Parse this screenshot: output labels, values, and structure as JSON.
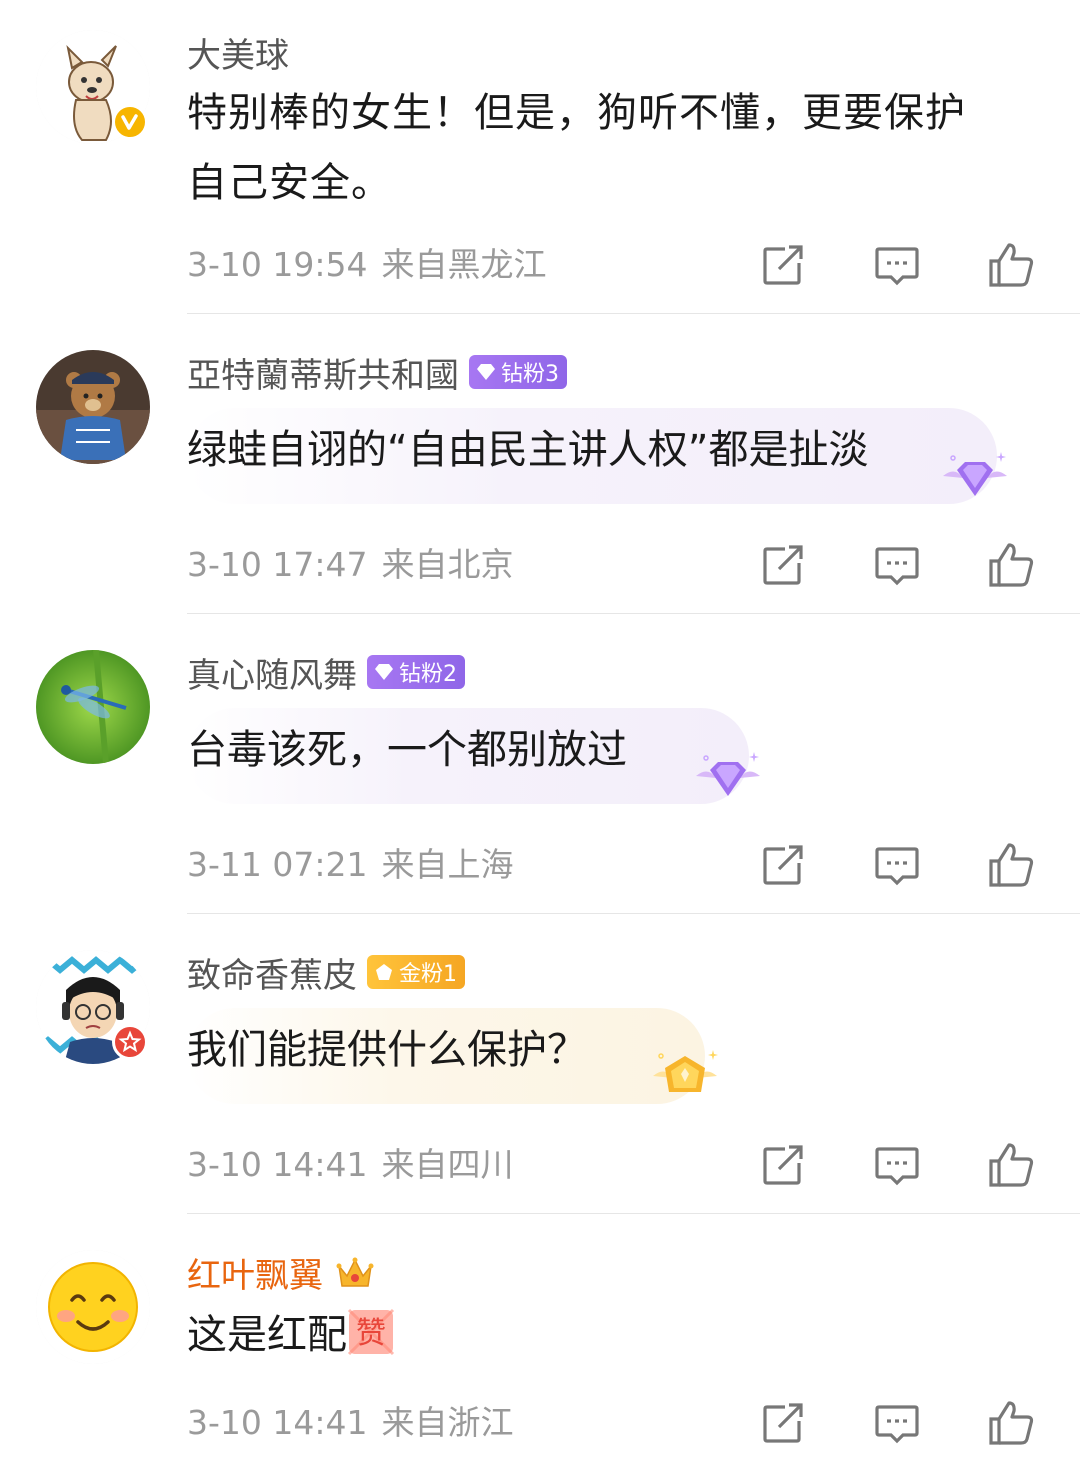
{
  "comments": [
    {
      "username": "大美球",
      "text_line1": "特别棒的女生！但是，狗听不懂，更要保护",
      "text_line2": "自己安全。",
      "time": "3-10 19:54",
      "location": "来自黑龙江"
    },
    {
      "username": "亞特蘭蒂斯共和國",
      "badge": "钻粉3",
      "text": "绿蛙自诩的“自由民主讲人权”都是扯淡",
      "time": "3-10 17:47",
      "location": "来自北京"
    },
    {
      "username": "真心随风舞",
      "badge": "钻粉2",
      "text": "台毒该死，一个都别放过",
      "time": "3-11 07:21",
      "location": "来自上海"
    },
    {
      "username": "致命香蕉皮",
      "badge": "金粉1",
      "text": "我们能提供什么保护？",
      "time": "3-10 14:41",
      "location": "来自四川"
    },
    {
      "username": "红叶飘翼",
      "text": "这是红配",
      "emoji_text": "赞",
      "time": "3-10 14:41",
      "location": "来自浙江"
    }
  ],
  "icons": {
    "share": "share-icon",
    "comment": "comment-icon",
    "like": "like-icon"
  },
  "colors": {
    "meta_gray": "#9a9a9a",
    "username_gray": "#555555",
    "username_red": "#e8650f",
    "diamond_badge": "#9b6ff0",
    "gold_badge": "#f7b52c",
    "verified_yellow": "#f7b500",
    "vip_red": "#e8463a"
  }
}
